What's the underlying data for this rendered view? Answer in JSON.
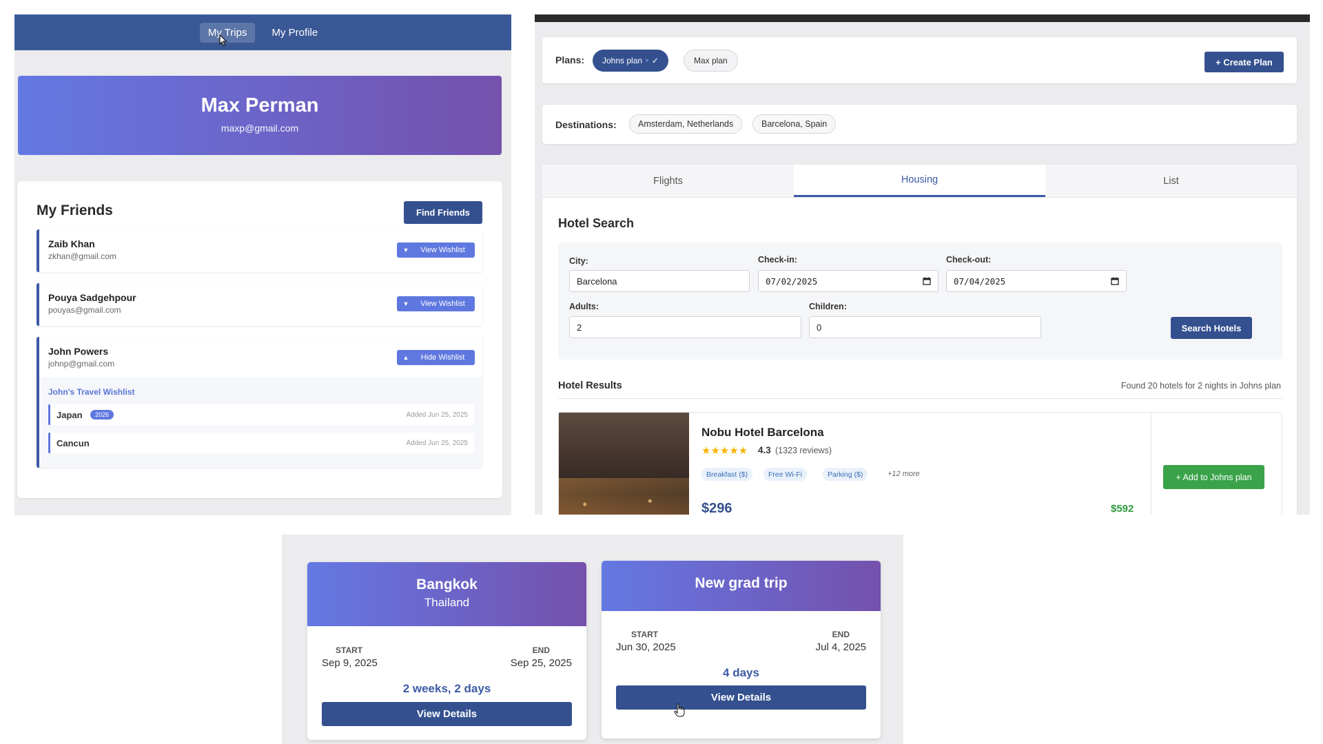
{
  "profile_app": {
    "nav": {
      "tabs": [
        {
          "label": "My Trips"
        },
        {
          "label": "My Profile"
        }
      ]
    },
    "user": {
      "name": "Max Perman",
      "email": "maxp@gmail.com"
    },
    "friends": {
      "title": "My Friends",
      "find_button": "Find Friends",
      "items": [
        {
          "name": "Zaib Khan",
          "email": "zkhan@gmail.com",
          "button": "View Wishlist",
          "toggle_icon": "triangle-down-icon"
        },
        {
          "name": "Pouya Sadgehpour",
          "email": "pouyas@gmail.com",
          "button": "View Wishlist",
          "toggle_icon": "triangle-down-icon"
        },
        {
          "name": "John Powers",
          "email": "johnp@gmail.com",
          "button": "Hide Wishlist",
          "toggle_icon": "triangle-up-icon"
        }
      ],
      "wishlist": {
        "title": "John's Travel Wishlist",
        "items": [
          {
            "name": "Japan",
            "badge": "2026",
            "added": "Added Jun 25, 2025"
          },
          {
            "name": "Cancun",
            "added": "Added Jun 25, 2025"
          }
        ]
      }
    }
  },
  "planner_app": {
    "plans": {
      "label": "Plans:",
      "selected": "Johns plan",
      "selected_marks": {
        "remove": "×",
        "check": "✓"
      },
      "other": "Max plan",
      "create_button": "+ Create Plan"
    },
    "destinations": {
      "label": "Destinations:",
      "items": [
        "Amsterdam, Netherlands",
        "Barcelona, Spain"
      ]
    },
    "tabs": [
      {
        "label": "Flights"
      },
      {
        "label": "Housing"
      },
      {
        "label": "List"
      }
    ],
    "active_tab": "Housing",
    "hotel_search": {
      "title": "Hotel Search",
      "city": {
        "label": "City:",
        "value": "Barcelona"
      },
      "checkin": {
        "label": "Check-in:",
        "value": "07/02/2025"
      },
      "checkout": {
        "label": "Check-out:",
        "value": "07/04/2025"
      },
      "adults": {
        "label": "Adults:",
        "value": "2"
      },
      "children": {
        "label": "Children:",
        "value": "0"
      },
      "search_button": "Search Hotels"
    },
    "results": {
      "title": "Hotel Results",
      "summary": "Found 20 hotels for 2 nights in Johns plan",
      "hotel": {
        "name": "Nobu Hotel Barcelona",
        "stars": "★★★★★",
        "rating": "4.3",
        "reviews": "(1323 reviews)",
        "amenities": [
          "Breakfast ($)",
          "Free Wi-Fi",
          "Parking ($)"
        ],
        "more": "+12 more",
        "price": "$296",
        "total": "$592",
        "add_button": "+ Add to Johns plan"
      }
    }
  },
  "trips_app": {
    "trips": [
      {
        "city": "Bangkok",
        "country": "Thailand",
        "start_label": "START",
        "start": "Sep 9, 2025",
        "end_label": "END",
        "end": "Sep 25, 2025",
        "duration": "2 weeks, 2 days",
        "button": "View Details"
      },
      {
        "city": "New grad trip",
        "start_label": "START",
        "start": "Jun 30, 2025",
        "end_label": "END",
        "end": "Jul 4, 2025",
        "duration": "4 days",
        "button": "View Details"
      }
    ]
  },
  "colors": {
    "primary": "#34508f",
    "accent": "#5f78df",
    "gradient_start": "#6478e3",
    "gradient_end": "#7451ad",
    "success": "#3aa34a",
    "star": "#f5b301"
  }
}
